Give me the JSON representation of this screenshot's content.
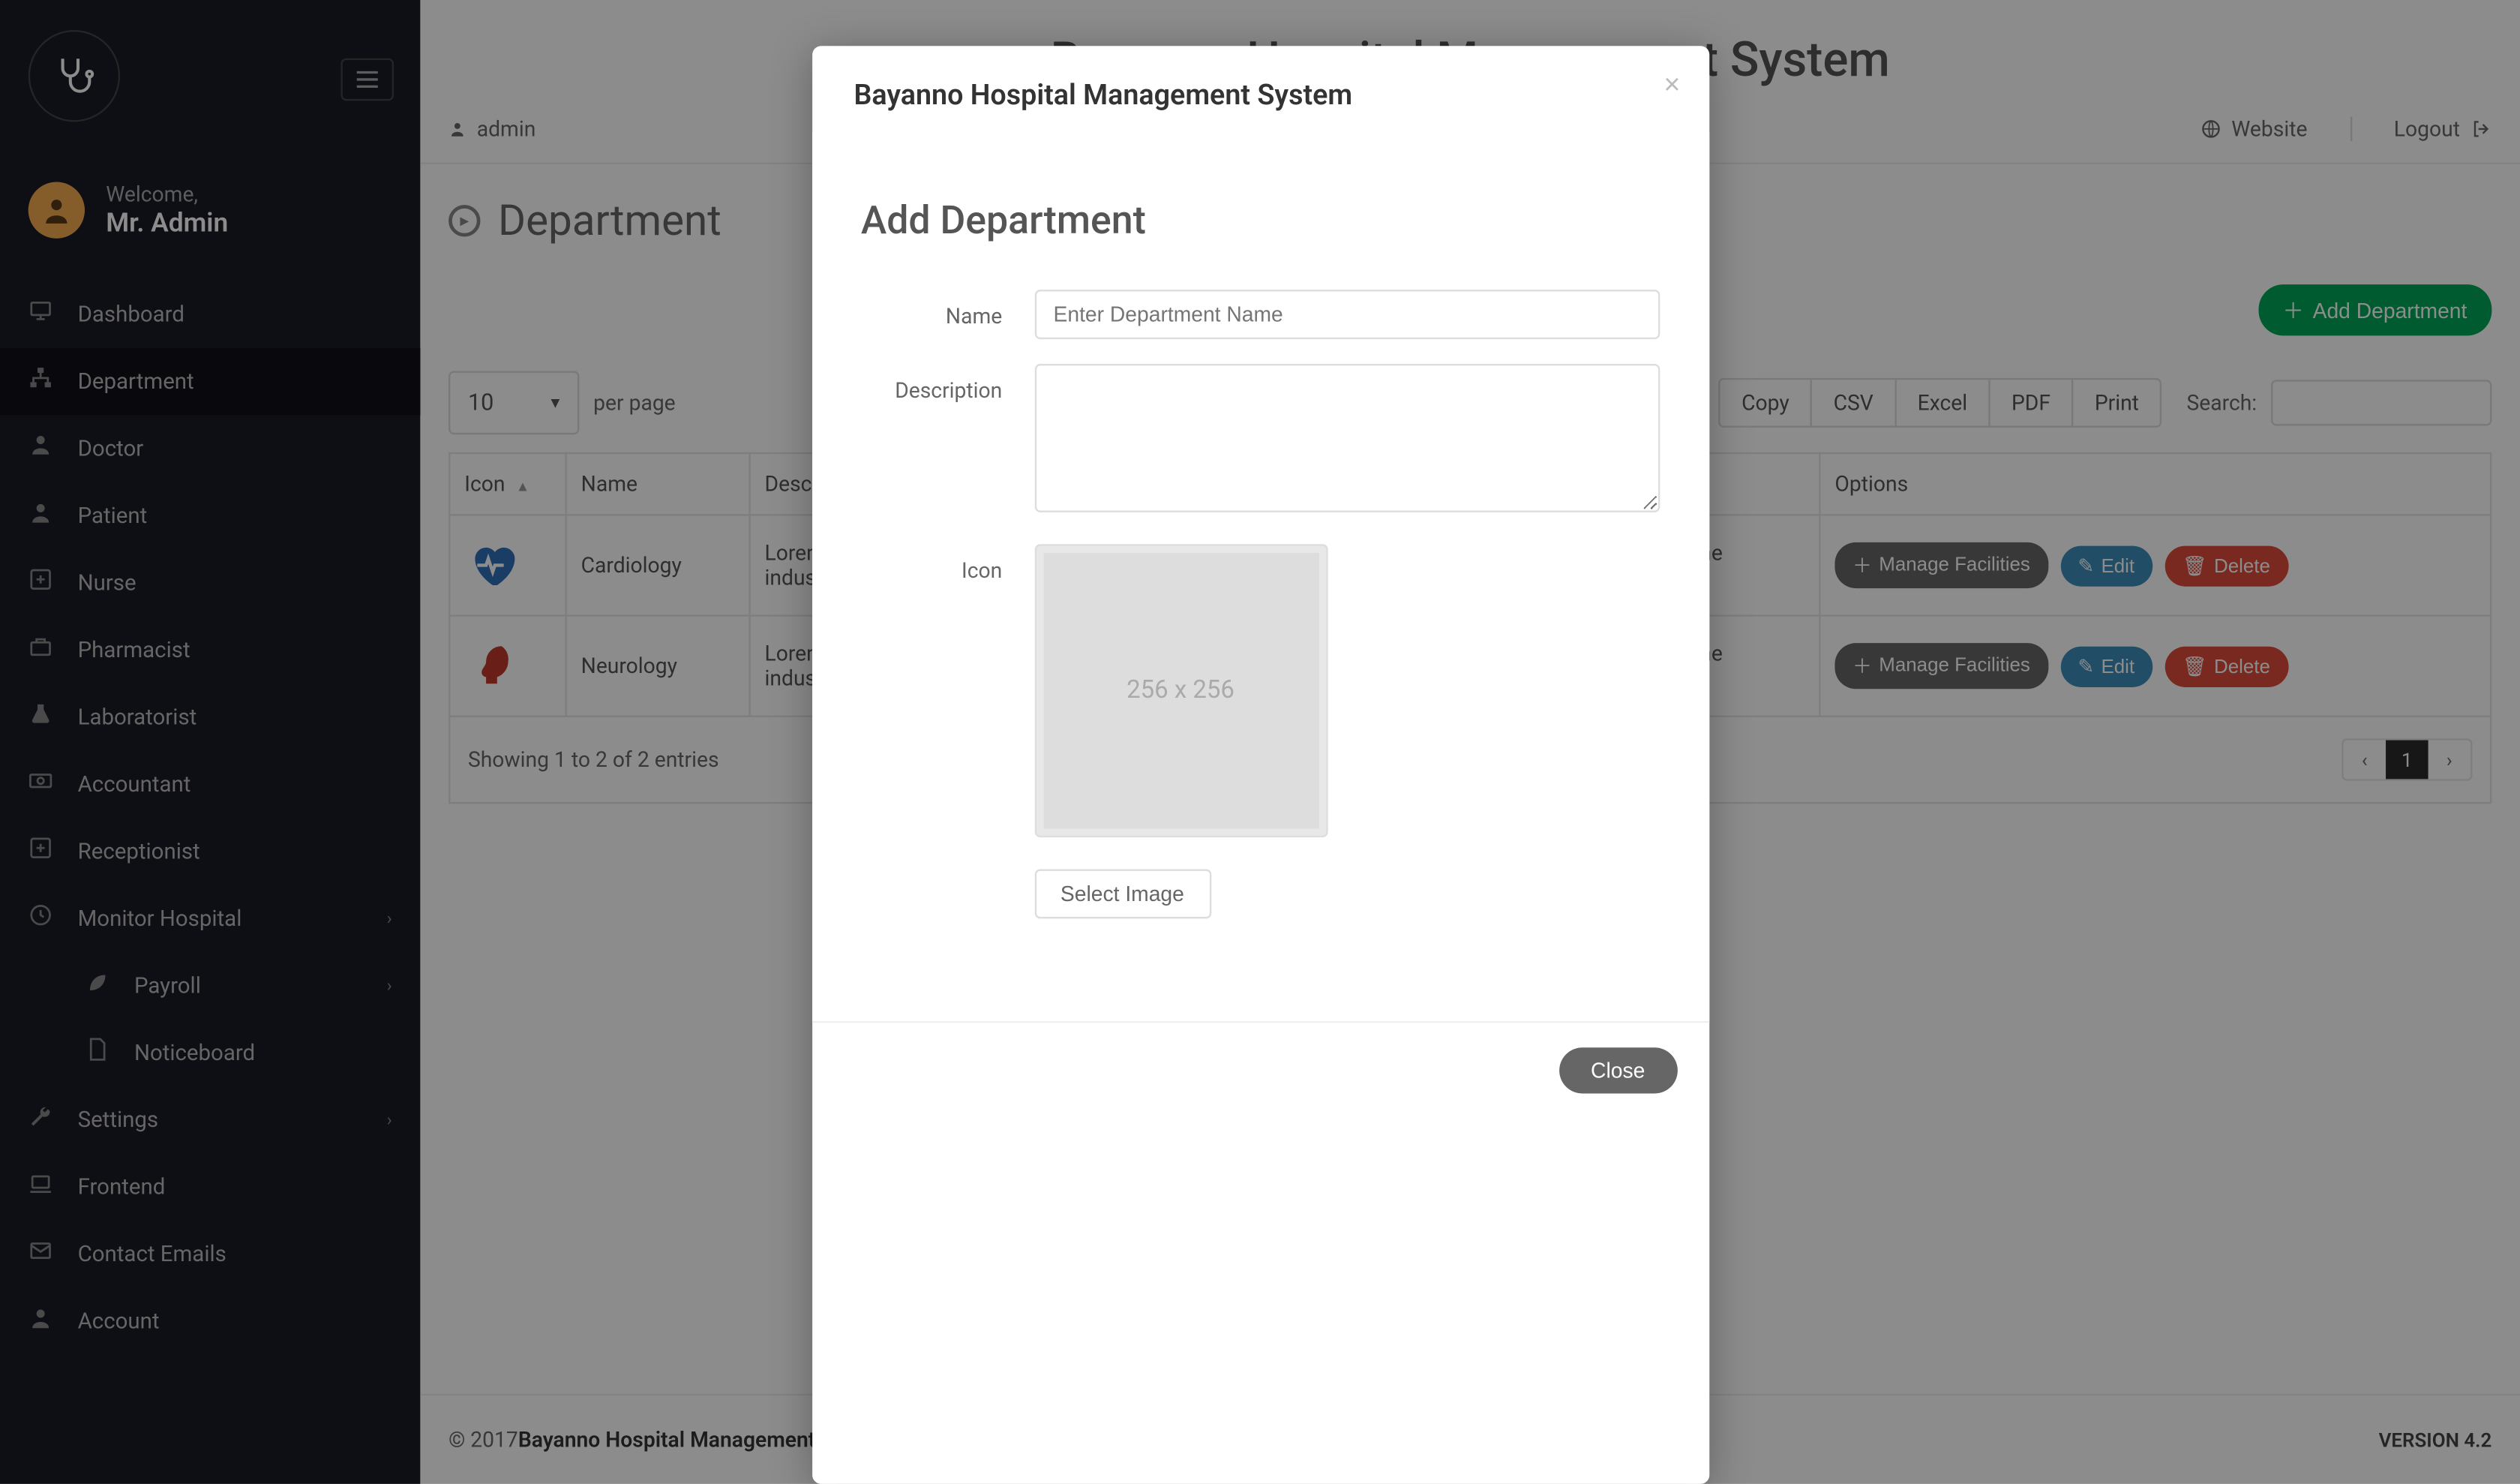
{
  "app": {
    "brand_title": "Bayanno Hospital Management System"
  },
  "topbar": {
    "user_label": "admin",
    "website_label": "Website",
    "logout_label": "Logout"
  },
  "sidebar": {
    "welcome": "Welcome,",
    "username": "Mr. Admin",
    "items": [
      {
        "icon": "monitor",
        "label": "Dashboard"
      },
      {
        "icon": "sitemap",
        "label": "Department",
        "active": true
      },
      {
        "icon": "user-md",
        "label": "Doctor"
      },
      {
        "icon": "user",
        "label": "Patient"
      },
      {
        "icon": "plus-square",
        "label": "Nurse"
      },
      {
        "icon": "briefcase",
        "label": "Pharmacist"
      },
      {
        "icon": "flask",
        "label": "Laboratorist"
      },
      {
        "icon": "money",
        "label": "Accountant"
      },
      {
        "icon": "plus-square",
        "label": "Receptionist"
      },
      {
        "icon": "clock",
        "label": "Monitor Hospital",
        "chev": true
      },
      {
        "icon": "leaf",
        "label": "Payroll",
        "chev": true,
        "indent": true
      },
      {
        "icon": "file",
        "label": "Noticeboard",
        "indent": true
      },
      {
        "icon": "wrench",
        "label": "Settings",
        "chev": true
      },
      {
        "icon": "laptop",
        "label": "Frontend"
      },
      {
        "icon": "envelope",
        "label": "Contact Emails"
      },
      {
        "icon": "user",
        "label": "Account"
      }
    ]
  },
  "page": {
    "title": "Department",
    "add_button": "Add Department"
  },
  "table": {
    "per_page_value": "10",
    "per_page_label": "per page",
    "export": {
      "copy": "Copy",
      "csv": "CSV",
      "excel": "Excel",
      "pdf": "PDF",
      "print": "Print"
    },
    "search_label": "Search:",
    "columns": {
      "icon": "Icon",
      "name": "Name",
      "description": "Description",
      "options": "Options"
    },
    "rows": [
      {
        "name": "Cardiology",
        "icon_color": "#2f6fb7",
        "description": "Lorem Ipsum is simply dummy text of the printing and typesetting industry. Lorem Ipsum has been the industry's standard"
      },
      {
        "name": "Neurology",
        "icon_color": "#c0392b",
        "description": "Lorem Ipsum is simply dummy text of the printing and typesetting industry. Lorem Ipsum has been the industry's standard"
      }
    ],
    "actions": {
      "manage": "Manage Facilities",
      "edit": "Edit",
      "delete": "Delete"
    },
    "info": "Showing 1 to 2 of 2 entries",
    "page_current": "1"
  },
  "footer": {
    "copyright_prefix": "© 2017 ",
    "brand": "Bayanno Hospital Management System",
    "version": "VERSION 4.2"
  },
  "modal": {
    "header_title": "Bayanno Hospital Management System",
    "title": "Add Department",
    "labels": {
      "name": "Name",
      "description": "Description",
      "icon": "Icon"
    },
    "placeholders": {
      "name": "Enter Department Name"
    },
    "preview_text": "256 x 256",
    "select_image": "Select Image",
    "close": "Close"
  }
}
